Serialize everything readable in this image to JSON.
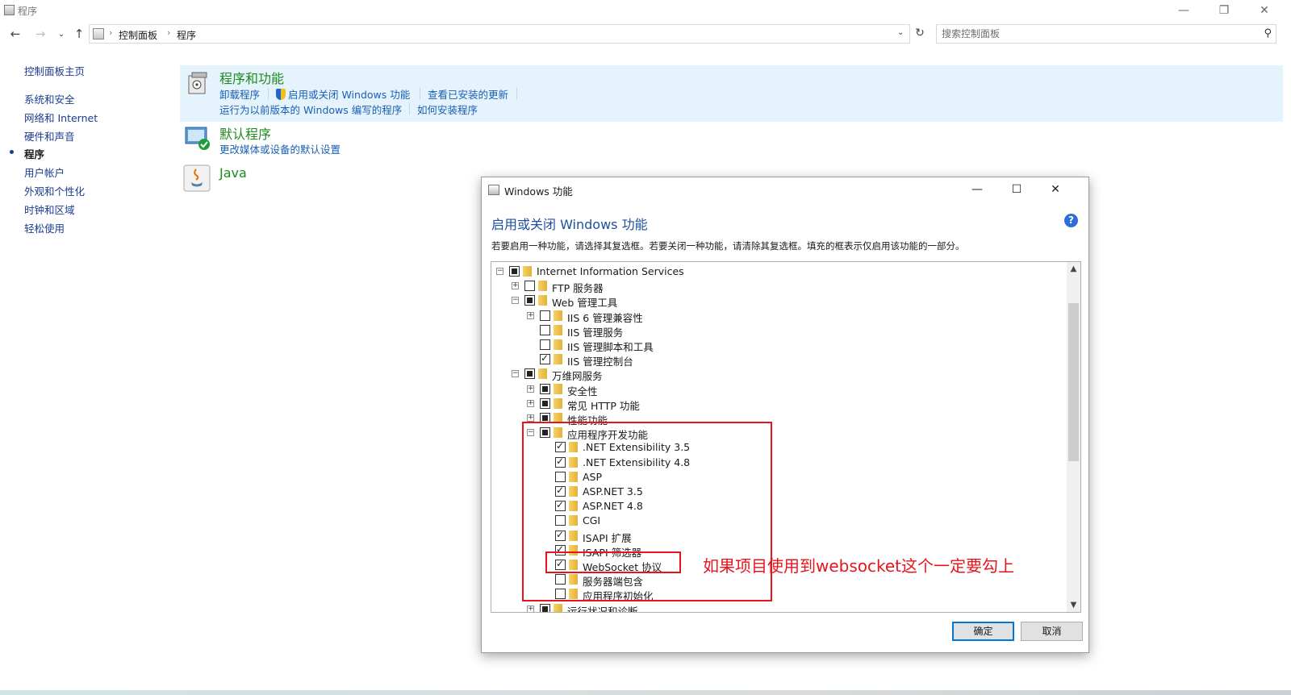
{
  "window": {
    "title": "程序"
  },
  "address": {
    "crumbs": [
      "控制面板",
      "程序"
    ],
    "search_placeholder": "搜索控制面板"
  },
  "leftnav": {
    "items": [
      {
        "label": "控制面板主页",
        "active": false
      },
      {
        "label": "系统和安全",
        "active": false
      },
      {
        "label": "网络和 Internet",
        "active": false
      },
      {
        "label": "硬件和声音",
        "active": false
      },
      {
        "label": "程序",
        "active": true
      },
      {
        "label": "用户帐户",
        "active": false
      },
      {
        "label": "外观和个性化",
        "active": false
      },
      {
        "label": "时钟和区域",
        "active": false
      },
      {
        "label": "轻松使用",
        "active": false
      }
    ]
  },
  "sections": {
    "programs": {
      "title": "程序和功能",
      "links": [
        "卸载程序",
        "启用或关闭 Windows 功能",
        "查看已安装的更新",
        "运行为以前版本的 Windows 编写的程序",
        "如何安装程序"
      ]
    },
    "defaults": {
      "title": "默认程序",
      "links": [
        "更改媒体或设备的默认设置"
      ]
    },
    "java": {
      "title": "Java"
    }
  },
  "dialog": {
    "title": "Windows 功能",
    "heading": "启用或关闭 Windows 功能",
    "description": "若要启用一种功能，请选择其复选框。若要关闭一种功能，请清除其复选框。填充的框表示仅启用该功能的一部分。",
    "ok_label": "确定",
    "cancel_label": "取消",
    "tree": [
      {
        "label": "Internet Information Services",
        "level": 0,
        "expander": "minus",
        "state": "partial"
      },
      {
        "label": "FTP 服务器",
        "level": 1,
        "expander": "plus",
        "state": "unchecked"
      },
      {
        "label": "Web 管理工具",
        "level": 1,
        "expander": "minus",
        "state": "partial"
      },
      {
        "label": "IIS 6 管理兼容性",
        "level": 2,
        "expander": "plus",
        "state": "unchecked"
      },
      {
        "label": "IIS 管理服务",
        "level": 2,
        "expander": "none",
        "state": "unchecked"
      },
      {
        "label": "IIS 管理脚本和工具",
        "level": 2,
        "expander": "none",
        "state": "unchecked"
      },
      {
        "label": "IIS 管理控制台",
        "level": 2,
        "expander": "none",
        "state": "checked"
      },
      {
        "label": "万维网服务",
        "level": 1,
        "expander": "minus",
        "state": "partial"
      },
      {
        "label": "安全性",
        "level": 2,
        "expander": "plus",
        "state": "partial"
      },
      {
        "label": "常见 HTTP 功能",
        "level": 2,
        "expander": "plus",
        "state": "partial"
      },
      {
        "label": "性能功能",
        "level": 2,
        "expander": "plus",
        "state": "partial"
      },
      {
        "label": "应用程序开发功能",
        "level": 2,
        "expander": "minus",
        "state": "partial"
      },
      {
        "label": ".NET Extensibility 3.5",
        "level": 3,
        "expander": "none",
        "state": "checked"
      },
      {
        "label": ".NET Extensibility 4.8",
        "level": 3,
        "expander": "none",
        "state": "checked"
      },
      {
        "label": "ASP",
        "level": 3,
        "expander": "none",
        "state": "unchecked"
      },
      {
        "label": "ASP.NET 3.5",
        "level": 3,
        "expander": "none",
        "state": "checked"
      },
      {
        "label": "ASP.NET 4.8",
        "level": 3,
        "expander": "none",
        "state": "checked"
      },
      {
        "label": "CGI",
        "level": 3,
        "expander": "none",
        "state": "unchecked"
      },
      {
        "label": "ISAPI 扩展",
        "level": 3,
        "expander": "none",
        "state": "checked"
      },
      {
        "label": "ISAPI 筛选器",
        "level": 3,
        "expander": "none",
        "state": "checked"
      },
      {
        "label": "WebSocket 协议",
        "level": 3,
        "expander": "none",
        "state": "checked"
      },
      {
        "label": "服务器端包含",
        "level": 3,
        "expander": "none",
        "state": "unchecked"
      },
      {
        "label": "应用程序初始化",
        "level": 3,
        "expander": "none",
        "state": "unchecked"
      },
      {
        "label": "运行状况和诊断",
        "level": 2,
        "expander": "plus",
        "state": "partial"
      }
    ]
  },
  "annotation": {
    "text": "如果项目使用到websocket这个一定要勾上",
    "color": "#e8141d"
  }
}
